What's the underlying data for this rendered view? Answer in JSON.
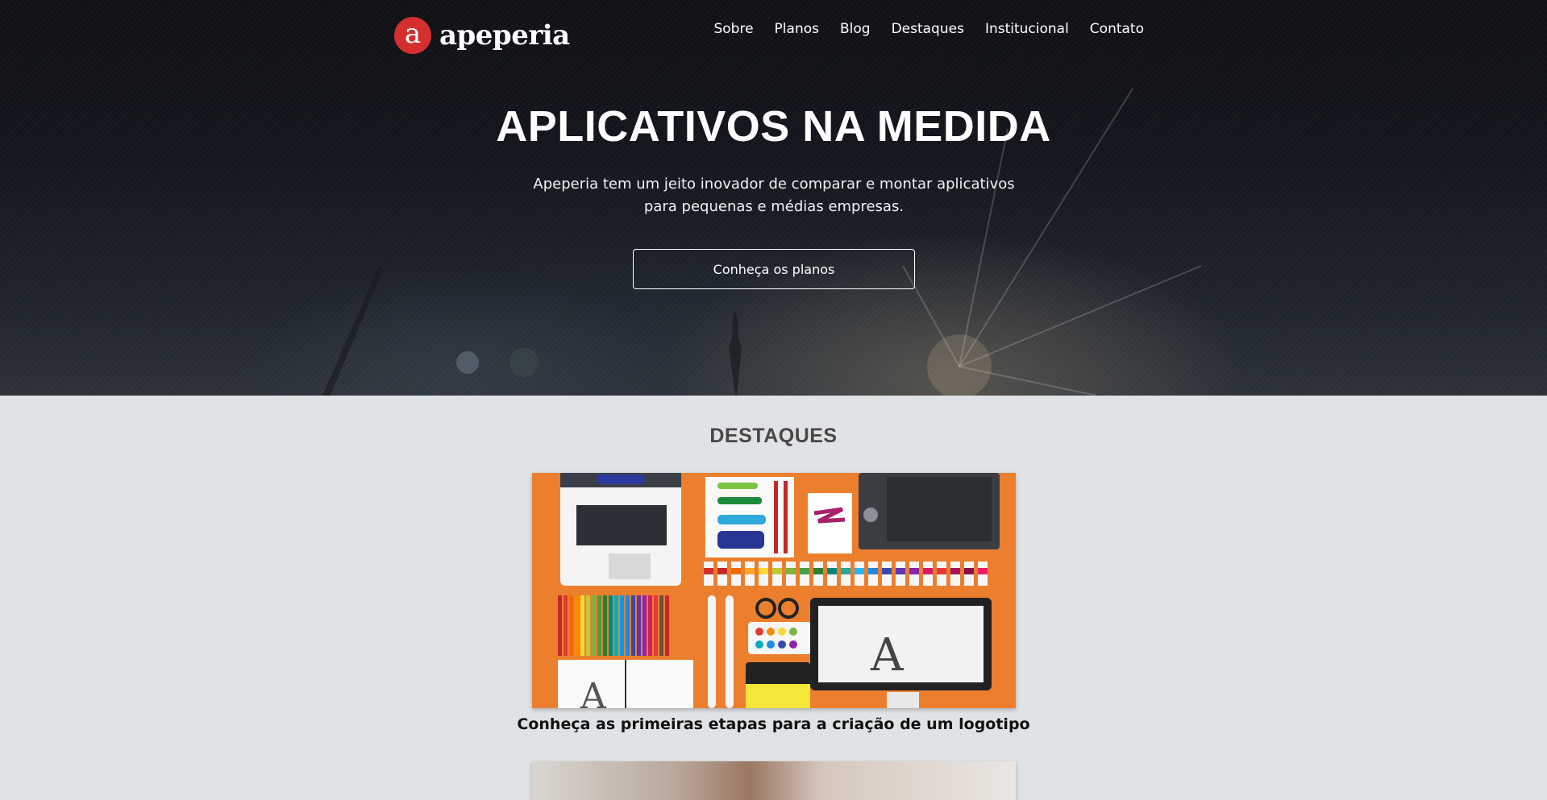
{
  "brand": {
    "logo_letter": "a",
    "name": "apeperia",
    "accent": "#d42f2f"
  },
  "nav": {
    "items": [
      {
        "label": "Sobre"
      },
      {
        "label": "Planos"
      },
      {
        "label": "Blog"
      },
      {
        "label": "Destaques"
      },
      {
        "label": "Institucional"
      },
      {
        "label": "Contato"
      }
    ]
  },
  "hero": {
    "title": "APLICATIVOS NA MEDIDA",
    "subtitle": "Apeperia tem um jeito inovador de comparar e montar aplicativos para pequenas e médias empresas.",
    "cta_label": "Conheça os planos"
  },
  "featured": {
    "title": "DESTAQUES",
    "cards": [
      {
        "caption": "Conheça as primeiras etapas para a criação de um logotipo",
        "image_bg": "#ec7f2d"
      }
    ]
  },
  "colors": {
    "section_bg": "#e0e3e5",
    "hero_bg": "#14161d"
  }
}
